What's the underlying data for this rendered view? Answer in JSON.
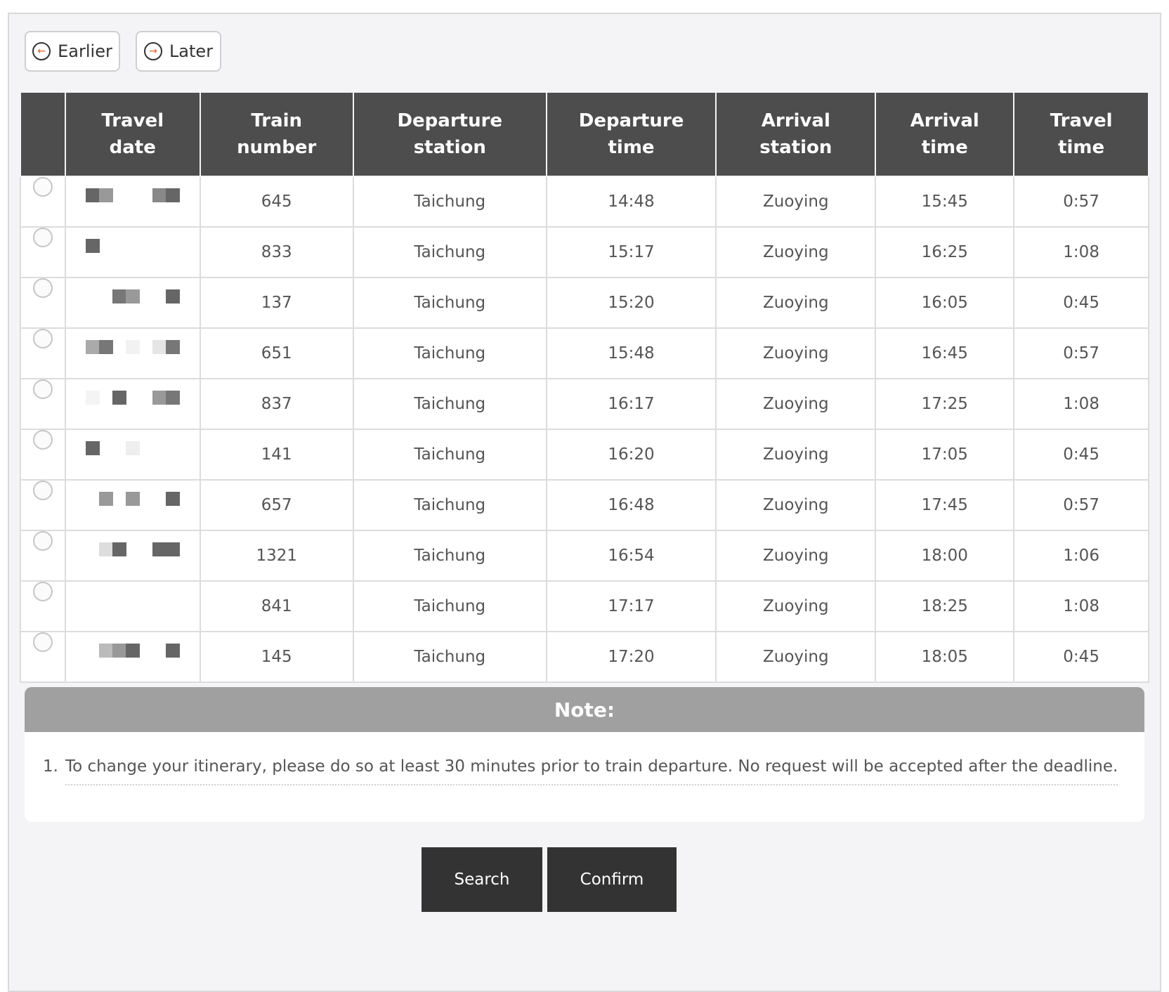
{
  "nav": {
    "earlier_label": "Earlier",
    "later_label": "Later"
  },
  "table": {
    "headers": {
      "travel_date": [
        "Travel",
        "date"
      ],
      "train_number": [
        "Train",
        "number"
      ],
      "departure_station": [
        "Departure",
        "station"
      ],
      "departure_time": [
        "Departure",
        "time"
      ],
      "arrival_station": [
        "Arrival",
        "station"
      ],
      "arrival_time": [
        "Arrival",
        "time"
      ],
      "travel_time": [
        "Travel",
        "time"
      ]
    },
    "rows": [
      {
        "train": "645",
        "from": "Taichung",
        "dep": "14:48",
        "to": "Zuoying",
        "arr": "15:45",
        "dur": "0:57"
      },
      {
        "train": "833",
        "from": "Taichung",
        "dep": "15:17",
        "to": "Zuoying",
        "arr": "16:25",
        "dur": "1:08"
      },
      {
        "train": "137",
        "from": "Taichung",
        "dep": "15:20",
        "to": "Zuoying",
        "arr": "16:05",
        "dur": "0:45"
      },
      {
        "train": "651",
        "from": "Taichung",
        "dep": "15:48",
        "to": "Zuoying",
        "arr": "16:45",
        "dur": "0:57"
      },
      {
        "train": "837",
        "from": "Taichung",
        "dep": "16:17",
        "to": "Zuoying",
        "arr": "17:25",
        "dur": "1:08"
      },
      {
        "train": "141",
        "from": "Taichung",
        "dep": "16:20",
        "to": "Zuoying",
        "arr": "17:05",
        "dur": "0:45"
      },
      {
        "train": "657",
        "from": "Taichung",
        "dep": "16:48",
        "to": "Zuoying",
        "arr": "17:45",
        "dur": "0:57"
      },
      {
        "train": "1321",
        "from": "Taichung",
        "dep": "16:54",
        "to": "Zuoying",
        "arr": "18:00",
        "dur": "1:06"
      },
      {
        "train": "841",
        "from": "Taichung",
        "dep": "17:17",
        "to": "Zuoying",
        "arr": "18:25",
        "dur": "1:08"
      },
      {
        "train": "145",
        "from": "Taichung",
        "dep": "17:20",
        "to": "Zuoying",
        "arr": "18:05",
        "dur": "0:45"
      }
    ]
  },
  "note": {
    "title": "Note:",
    "items": [
      {
        "number": "1.",
        "text": "To change your itinerary, please do so at least 30 minutes prior to train departure. No request will be accepted after the deadline."
      }
    ]
  },
  "actions": {
    "search_label": "Search",
    "confirm_label": "Confirm"
  }
}
